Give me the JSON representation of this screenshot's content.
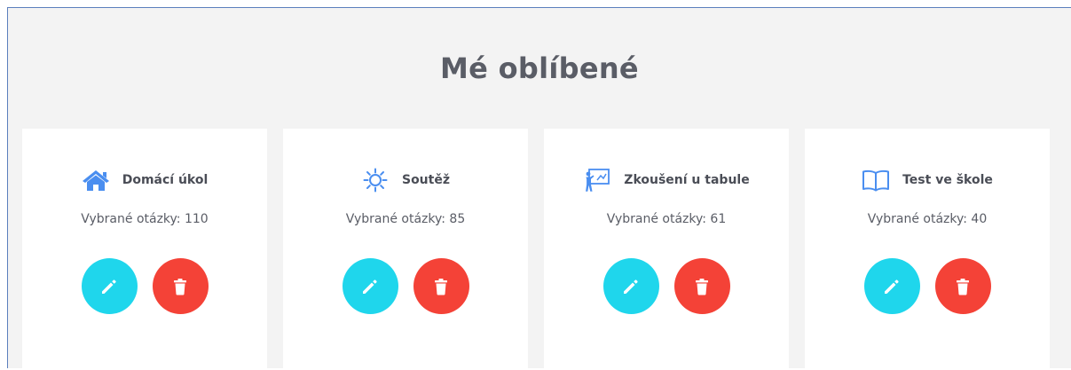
{
  "page": {
    "title": "Mé oblíbené"
  },
  "colors": {
    "accent_icon": "#4a8ef0",
    "edit": "#1fd6ec",
    "delete": "#f44237",
    "background": "#f3f3f3",
    "card": "#ffffff"
  },
  "cards": [
    {
      "title": "Domácí úkol",
      "icon": "home-icon",
      "count_text": "Vybrané otázky: 110"
    },
    {
      "title": "Soutěž",
      "icon": "sun-icon",
      "count_text": "Vybrané otázky: 85"
    },
    {
      "title": "Zkoušení u tabule",
      "icon": "blackboard-icon",
      "count_text": "Vybrané otázky: 61"
    },
    {
      "title": "Test ve škole",
      "icon": "book-icon",
      "count_text": "Vybrané otázky: 40"
    }
  ],
  "actions": {
    "edit_icon": "pencil-icon",
    "delete_icon": "trash-icon"
  }
}
